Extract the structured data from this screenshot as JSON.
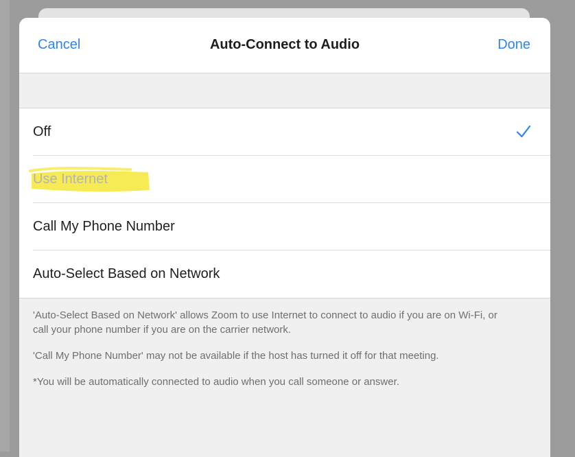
{
  "header": {
    "cancel_label": "Cancel",
    "title": "Auto-Connect to Audio",
    "done_label": "Done"
  },
  "options": [
    {
      "label": "Off",
      "selected": true,
      "enabled": true
    },
    {
      "label": "Use Internet",
      "selected": false,
      "enabled": false
    },
    {
      "label": "Call My Phone Number",
      "selected": false,
      "enabled": true
    },
    {
      "label": "Auto-Select Based on Network",
      "selected": false,
      "enabled": true
    }
  ],
  "footer": {
    "notes": [
      "'Auto-Select Based on Network' allows Zoom to use Internet to connect to audio if you are on Wi-Fi, or call your phone number if you are on the carrier network.",
      "'Call My Phone Number' may not be available if the host has turned it off for that meeting.",
      "*You will be automatically connected to audio when you call someone or answer."
    ]
  },
  "colors": {
    "accent": "#2e84ef",
    "highlight": "#f5e62f"
  },
  "icons": {
    "selected_mark": "checkmark-icon"
  }
}
